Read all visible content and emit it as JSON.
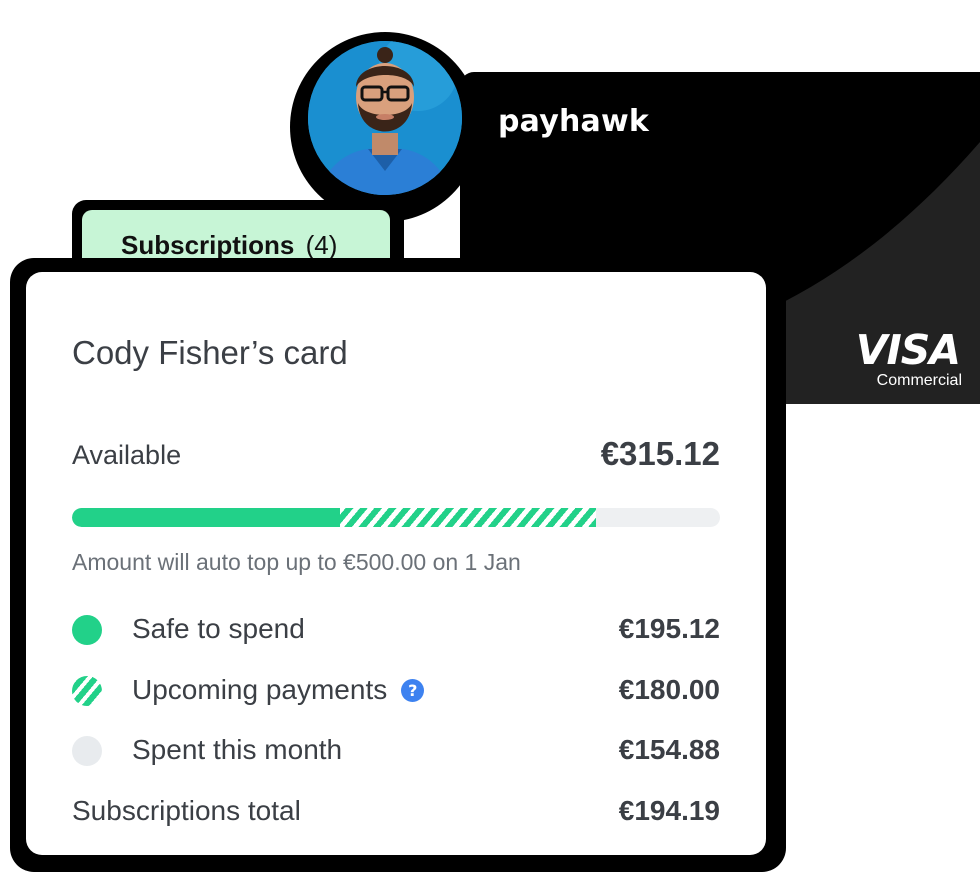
{
  "payment_card": {
    "brand": "payhawk",
    "network": "VISA",
    "network_tier": "Commercial"
  },
  "tab": {
    "title": "Subscriptions",
    "count": "(4)"
  },
  "card_panel": {
    "title": "Cody Fisher’s card",
    "available_label": "Available",
    "available_value": "€315.12",
    "progress": {
      "safe_fraction": 0.413,
      "upcoming_fraction": 0.395
    },
    "top_up_note": "Amount will auto top up to €500.00 on 1 Jan",
    "breakdown": [
      {
        "label": "Safe to spend",
        "value": "€195.12",
        "indicator": "solid-green"
      },
      {
        "label": "Upcoming payments",
        "value": "€180.00",
        "indicator": "striped-green",
        "help_icon": "?"
      },
      {
        "label": "Spent this month",
        "value": "€154.88",
        "indicator": "light-grey"
      }
    ],
    "total": {
      "label": "Subscriptions total",
      "value": "€194.19"
    }
  },
  "colors": {
    "accent_green": "#22d189",
    "tab_green": "#c7f5d6",
    "help_blue": "#3d82f0",
    "card_black": "#000000"
  }
}
